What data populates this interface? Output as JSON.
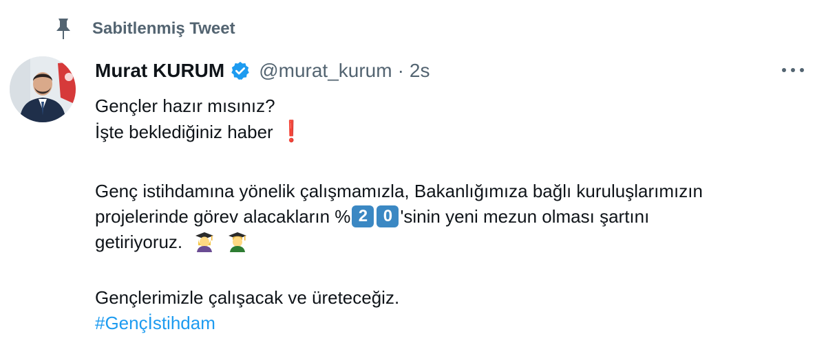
{
  "pinned": {
    "label": "Sabitlenmiş Tweet",
    "icon": "pin-icon"
  },
  "author": {
    "name": "Murat KURUM",
    "handle": "@murat_kurum",
    "separator": "·",
    "time": "2s",
    "verified_icon": "verified-badge-icon"
  },
  "tweet": {
    "line1": "Gençler hazır mısınız?",
    "line2": "İşte beklediğiniz haber",
    "line3": "Genç istihdamına yönelik çalışmamızla, Bakanlığımıza bağlı kuruluşlarımızın",
    "line4_pre": "projelerinde görev alacakların %",
    "keycap1": "2",
    "keycap2": "0",
    "line4_post": "'sinin yeni mezun olması şartını",
    "line5": "getiriyoruz.",
    "line6": "Gençlerimizle çalışacak ve üreteceğiz.",
    "hashtag": "#Gençİstihdam",
    "emojis": [
      "exclamation-mark-emoji",
      "graduate-woman-emoji",
      "graduate-man-emoji"
    ]
  },
  "colors": {
    "link": "#1d9bf0",
    "secondary": "#536471",
    "keycap": "#3b88c3"
  }
}
